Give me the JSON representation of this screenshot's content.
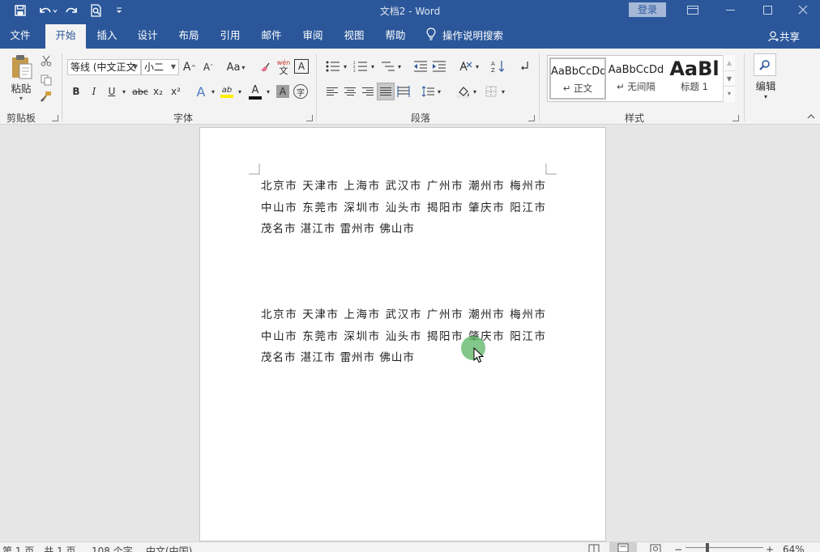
{
  "window": {
    "title": "文档2  -  Word",
    "login_label": "登录",
    "controls": [
      "⊡",
      "—",
      "☐",
      "✕"
    ]
  },
  "quick_access": {
    "save_icon": "save-icon",
    "undo_icon": "undo-icon",
    "redo_icon": "redo-icon",
    "print_preview_icon": "print-preview-icon",
    "customize_icon": "customize-icon"
  },
  "tabs": [
    {
      "label": "文件"
    },
    {
      "label": "开始"
    },
    {
      "label": "插入"
    },
    {
      "label": "设计"
    },
    {
      "label": "布局"
    },
    {
      "label": "引用"
    },
    {
      "label": "邮件"
    },
    {
      "label": "审阅"
    },
    {
      "label": "视图"
    },
    {
      "label": "帮助"
    }
  ],
  "tell_me": "操作说明搜索",
  "share": "共享",
  "ribbon": {
    "clipboard": {
      "label": "剪贴板",
      "paste": "粘贴"
    },
    "font": {
      "label": "字体",
      "font_name": "等线 (中文正文",
      "font_size": "小二",
      "grow": "A",
      "shrink": "A",
      "case": "Aa",
      "phonetic_top": "wén",
      "phonetic_bottom": "文",
      "border_char": "A",
      "bold": "B",
      "italic": "I",
      "underline": "U",
      "strike": "abc",
      "subscript": "x₂",
      "superscript": "x²",
      "effects": "A",
      "highlight": "ab",
      "color": "A",
      "shading": "A",
      "enclose": "字"
    },
    "paragraph": {
      "label": "段落"
    },
    "styles": {
      "label": "样式",
      "items": [
        {
          "sample": "AaBbCcDd",
          "name": "↵ 正文"
        },
        {
          "sample": "AaBbCcDd",
          "name": "↵ 无间隔"
        },
        {
          "sample": "AaBl",
          "name": "标题 1"
        }
      ]
    },
    "editing": {
      "label": "编辑"
    }
  },
  "document": {
    "paragraph_1": "北京市 天津市 上海市 武汉市 广州市 潮州市 梅州市 中山市 东莞市 深圳市 汕头市 揭阳市 肇庆市 阳江市 茂名市 湛江市 雷州市 佛山市",
    "paragraph_2": "北京市 天津市 上海市 武汉市 广州市 潮州市 梅州市 中山市 东莞市 深圳市 汕头市 揭阳市 肇庆市 阳江市 茂名市 湛江市 雷州市 佛山市"
  },
  "status": {
    "page": "第 1 页，共 1 页",
    "words": "108 个字",
    "language": "中文(中国)",
    "zoom": "64%"
  },
  "colors": {
    "accent": "#2b579a",
    "ribbon_bg": "#f3f3f3",
    "doc_bg": "#e6e6e6",
    "cursor_dot": "#5ab464"
  }
}
